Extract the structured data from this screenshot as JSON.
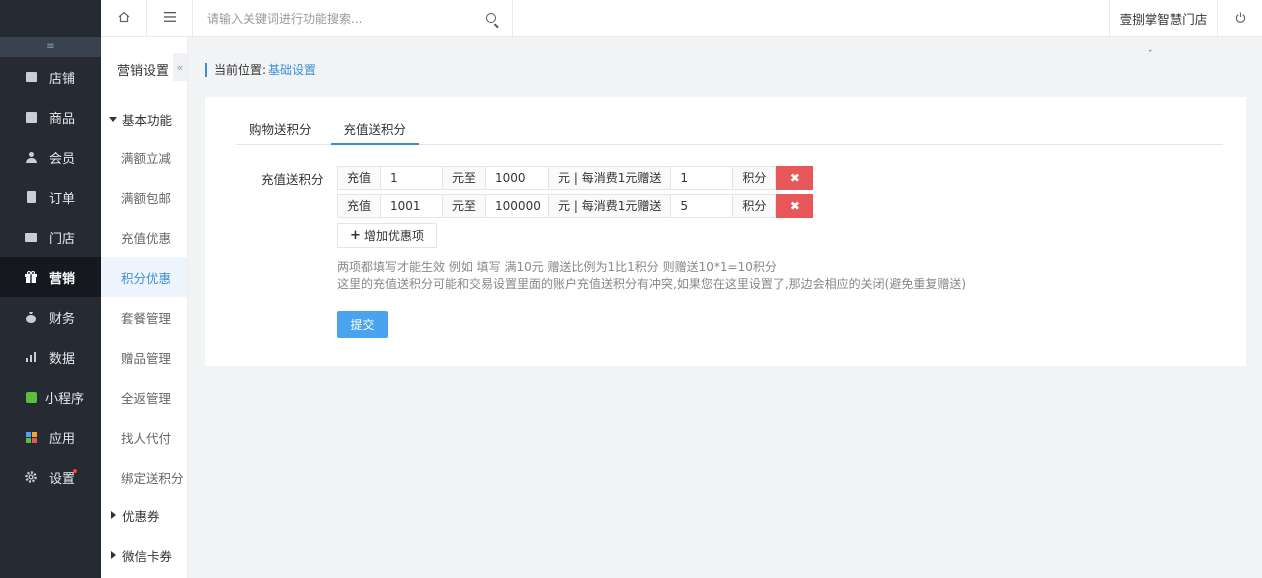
{
  "topbar": {
    "search_placeholder": "请输入关键词进行功能搜索...",
    "store_name": "壹捌掌智慧门店"
  },
  "sidebar": {
    "collapse_icon": "≡",
    "items": [
      {
        "label": "店铺",
        "icon": "store-icon"
      },
      {
        "label": "商品",
        "icon": "goods-icon"
      },
      {
        "label": "会员",
        "icon": "member-icon"
      },
      {
        "label": "订单",
        "icon": "order-icon"
      },
      {
        "label": "门店",
        "icon": "shop-icon"
      },
      {
        "label": "营销",
        "icon": "gift-icon",
        "active": true
      },
      {
        "label": "财务",
        "icon": "money-bag-icon"
      },
      {
        "label": "数据",
        "icon": "chart-icon"
      },
      {
        "label": "小程序",
        "icon": "miniprogram-icon"
      },
      {
        "label": "应用",
        "icon": "apps-icon"
      },
      {
        "label": "设置",
        "icon": "gear-icon",
        "badge_dot": true
      }
    ]
  },
  "subnav": {
    "title": "营销设置",
    "group_basic": "基本功能",
    "items": [
      "满额立减",
      "满额包邮",
      "充值优惠",
      "积分优惠",
      "套餐管理",
      "赠品管理",
      "全返管理",
      "找人代付",
      "绑定送积分"
    ],
    "active_item": "积分优惠",
    "group_coupon": "优惠券",
    "group_wechat": "微信卡券"
  },
  "breadcrumb": {
    "prefix": "当前位置:",
    "current": "基础设置"
  },
  "tabs": [
    {
      "label": "购物送积分",
      "active": false
    },
    {
      "label": "充值送积分",
      "active": true
    }
  ],
  "form": {
    "label": "充值送积分",
    "rows": [
      {
        "recharge_label": "充值",
        "from": "1",
        "to_label": "元至",
        "to": "1000",
        "mid_text": "元 | 每消费1元赠送",
        "points": "1",
        "unit": "积分"
      },
      {
        "recharge_label": "充值",
        "from": "1001",
        "to_label": "元至",
        "to": "100000",
        "mid_text": "元 | 每消费1元赠送",
        "points": "5",
        "unit": "积分"
      }
    ],
    "add_button": "增加优惠项",
    "hint_1": "两项都填写才能生效 例如 填写 满10元 赠送比例为1比1积分 则赠送10*1=10积分",
    "hint_2": "这里的充值送积分可能和交易设置里面的账户充值送积分有冲突,如果您在这里设置了,那边会相应的关闭(避免重复赠送)",
    "submit_button": "提交"
  },
  "colors": {
    "accent": "#3b8fd4",
    "delete": "#e8585b",
    "submit": "#4aa3ee",
    "sidebar_bg": "#262b33"
  }
}
